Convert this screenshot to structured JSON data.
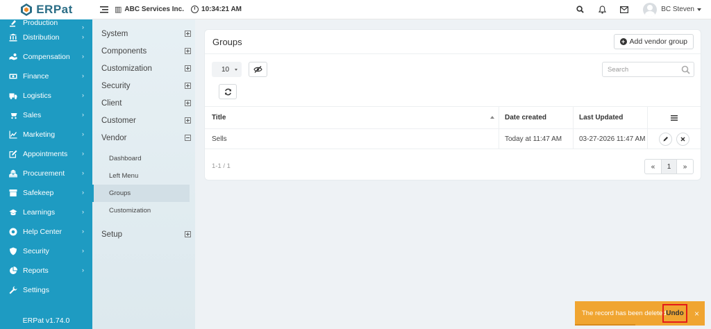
{
  "brand": {
    "name": "ERPat",
    "color": "#2a6d86"
  },
  "topbar": {
    "company": "ABC Services Inc.",
    "time": "10:34:21 AM",
    "user": "BC Steven"
  },
  "sidebar": {
    "color": "#1e9bc2",
    "items": [
      {
        "label": "Production",
        "icon": "hammer-icon"
      },
      {
        "label": "Distribution",
        "icon": "bank-icon"
      },
      {
        "label": "Compensation",
        "icon": "hand-money-icon"
      },
      {
        "label": "Finance",
        "icon": "money-icon"
      },
      {
        "label": "Logistics",
        "icon": "truck-icon"
      },
      {
        "label": "Sales",
        "icon": "cart-icon"
      },
      {
        "label": "Marketing",
        "icon": "chart-line-icon"
      },
      {
        "label": "Appointments",
        "icon": "edit-icon"
      },
      {
        "label": "Procurement",
        "icon": "cubes-icon"
      },
      {
        "label": "Safekeep",
        "icon": "archive-icon"
      },
      {
        "label": "Learnings",
        "icon": "graduation-cap-icon"
      },
      {
        "label": "Help Center",
        "icon": "life-ring-icon"
      },
      {
        "label": "Security",
        "icon": "shield-icon"
      },
      {
        "label": "Reports",
        "icon": "pie-chart-icon"
      },
      {
        "label": "Settings",
        "icon": "wrench-icon"
      }
    ],
    "version": "ERPat v1.74.0"
  },
  "subnav": {
    "sections": [
      "System",
      "Components",
      "Customization",
      "Security",
      "Client",
      "Customer",
      "Vendor"
    ],
    "vendor_children": [
      "Dashboard",
      "Left Menu",
      "Groups",
      "Customization"
    ],
    "setup": "Setup"
  },
  "card": {
    "title": "Groups",
    "add_button": "Add vendor group",
    "page_size": "10",
    "search_placeholder": "Search",
    "columns": [
      "Title",
      "Date created",
      "Last Updated"
    ],
    "rows": [
      {
        "title": "Sells",
        "created": "Today at 11:47 AM",
        "updated": "03-27-2026 11:47 AM"
      }
    ],
    "pager_info": "1-1 / 1",
    "pager": {
      "prev": "«",
      "page": "1",
      "next": "»"
    }
  },
  "toast": {
    "message": "The record has been deleted",
    "undo": "Undo",
    "color": "#f0a531"
  }
}
